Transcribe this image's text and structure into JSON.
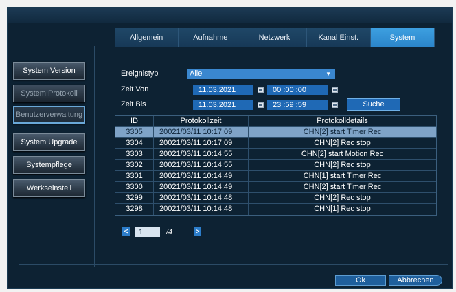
{
  "tabs": [
    {
      "label": "Allgemein"
    },
    {
      "label": "Aufnahme"
    },
    {
      "label": "Netzwerk"
    },
    {
      "label": "Kanal Einst."
    },
    {
      "label": "System"
    }
  ],
  "active_tab": "System",
  "sidebar": {
    "items": [
      {
        "label": "System Version"
      },
      {
        "label": "System Protokoll"
      },
      {
        "label": "Benutzerverwaltung"
      },
      {
        "label": "System Upgrade"
      },
      {
        "label": "Systempflege"
      },
      {
        "label": "Werkseinstell"
      }
    ]
  },
  "form": {
    "event_type_label": "Ereignistyp",
    "event_type_value": "Alle",
    "from_label": "Zeit Von",
    "from_date": "11.03.2021",
    "from_time": "00 :00 :00",
    "to_label": "Zeit Bis",
    "to_date": "11.03.2021",
    "to_time": "23 :59 :59",
    "search_label": "Suche"
  },
  "table": {
    "headers": [
      "ID",
      "Protokollzeit",
      "Protokolldetails"
    ],
    "rows": [
      {
        "id": "3305",
        "time": "20021/03/11  10:17:09",
        "details": "CHN[2] start Timer Rec"
      },
      {
        "id": "3304",
        "time": "20021/03/11  10:17:09",
        "details": "CHN[2] Rec stop"
      },
      {
        "id": "3303",
        "time": "20021/03/11  10:14:55",
        "details": "CHN[2] start Motion Rec"
      },
      {
        "id": "3302",
        "time": "20021/03/11  10:14:55",
        "details": "CHN[2] Rec stop"
      },
      {
        "id": "3301",
        "time": "20021/03/11  10:14:49",
        "details": "CHN[1] start Timer Rec"
      },
      {
        "id": "3300",
        "time": "20021/03/11  10:14:49",
        "details": "CHN[2] start Timer Rec"
      },
      {
        "id": "3299",
        "time": "20021/03/11  10:14:48",
        "details": "CHN[2] Rec stop"
      },
      {
        "id": "3298",
        "time": "20021/03/11  10:14:48",
        "details": "CHN[1] Rec stop"
      }
    ]
  },
  "pager": {
    "prev_icon": "chevron-left-icon",
    "next_icon": "chevron-right-icon",
    "prev_glyph": "<",
    "next_glyph": ">",
    "current_page": "1",
    "total_pages": "/4"
  },
  "footer": {
    "ok_label": "Ok",
    "cancel_label": "Abbrechen"
  },
  "colors": {
    "background": "#0d2233",
    "accent": "#3a87cf",
    "active_tab": "#2b86cb",
    "selected_row": "#7fa3c7"
  }
}
